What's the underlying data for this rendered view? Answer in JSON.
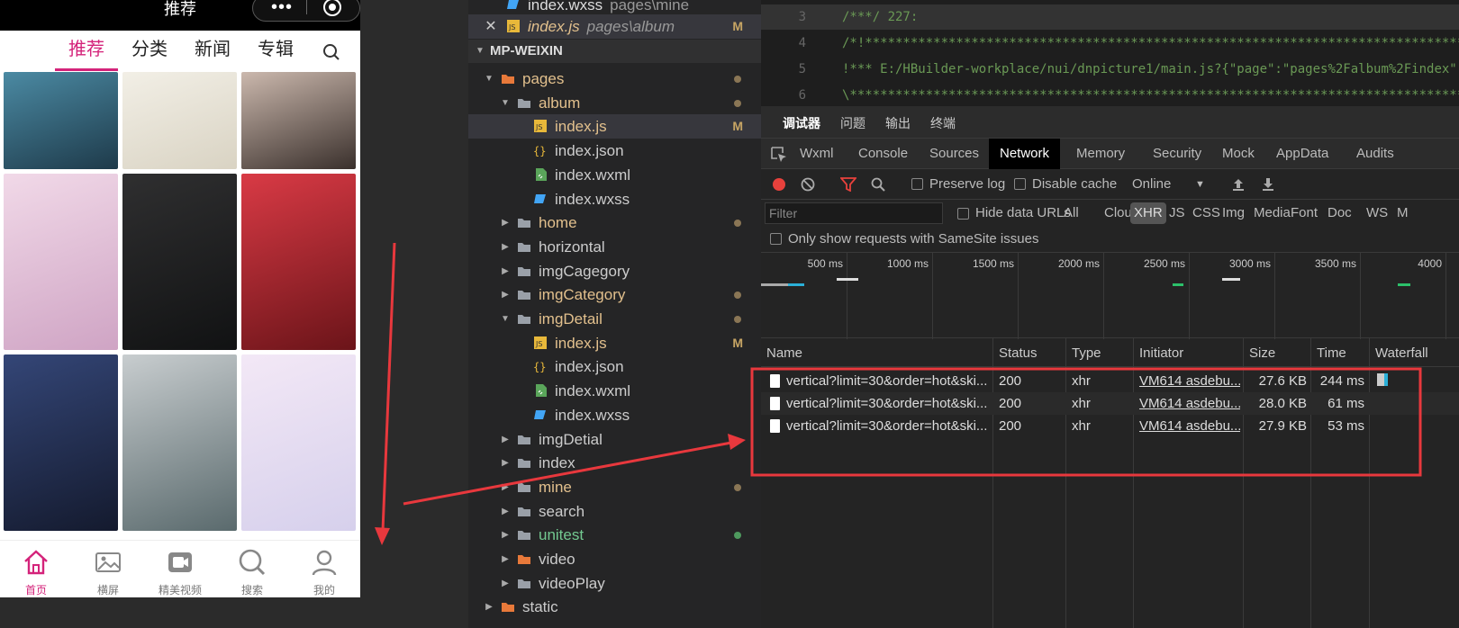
{
  "phone": {
    "title": "推荐",
    "nav": [
      "推荐",
      "分类",
      "新闻",
      "专辑"
    ],
    "tabs": [
      "首页",
      "横屏",
      "精美视频",
      "搜索",
      "我的"
    ],
    "accent": "#d4237a",
    "images": [
      {
        "name": "mountain-image",
        "colors": [
          "#4b8aa3",
          "#1e3a4a"
        ]
      },
      {
        "name": "meme-image",
        "colors": [
          "#f2efe6",
          "#d9d3c3"
        ]
      },
      {
        "name": "woman-dark-image",
        "colors": [
          "#cbb8ad",
          "#3a302c"
        ]
      },
      {
        "name": "woman-white-dress-image",
        "colors": [
          "#f1d9e8",
          "#cfa4c4"
        ]
      },
      {
        "name": "joker-image",
        "colors": [
          "#2f2f30",
          "#111213"
        ]
      },
      {
        "name": "red-costume-image",
        "colors": [
          "#d93a45",
          "#6b1419"
        ]
      },
      {
        "name": "superheroes-image",
        "colors": [
          "#344677",
          "#141a2e"
        ]
      },
      {
        "name": "woman-sequin-dress-image",
        "colors": [
          "#c8cdcf",
          "#5a6a6d"
        ]
      },
      {
        "name": "pastel-sky-image",
        "colors": [
          "#f3e8f6",
          "#d6d0ec"
        ]
      }
    ]
  },
  "explorer": {
    "open_file": {
      "name": "index.wxss",
      "path": "pages\\mine"
    },
    "active_tab": {
      "name": "index.js",
      "path": "pages\\album",
      "badge": "M"
    },
    "section": "MP-WEIXIN",
    "tree": [
      {
        "label": "pages",
        "kind": "folder-special",
        "depth": 0,
        "open": true,
        "status": "dot",
        "color": "mod"
      },
      {
        "label": "album",
        "kind": "folder",
        "depth": 1,
        "open": true,
        "status": "dot",
        "color": "mod"
      },
      {
        "label": "index.js",
        "kind": "js",
        "depth": 2,
        "status": "M",
        "color": "mod",
        "selected": true
      },
      {
        "label": "index.json",
        "kind": "json",
        "depth": 2
      },
      {
        "label": "index.wxml",
        "kind": "wxml",
        "depth": 2
      },
      {
        "label": "index.wxss",
        "kind": "wxss",
        "depth": 2
      },
      {
        "label": "home",
        "kind": "folder",
        "depth": 1,
        "open": false,
        "status": "dot",
        "color": "mod"
      },
      {
        "label": "horizontal",
        "kind": "folder",
        "depth": 1,
        "open": false
      },
      {
        "label": "imgCagegory",
        "kind": "folder",
        "depth": 1,
        "open": false
      },
      {
        "label": "imgCategory",
        "kind": "folder",
        "depth": 1,
        "open": false,
        "status": "dot",
        "color": "mod"
      },
      {
        "label": "imgDetail",
        "kind": "folder",
        "depth": 1,
        "open": true,
        "status": "dot",
        "color": "mod"
      },
      {
        "label": "index.js",
        "kind": "js",
        "depth": 2,
        "status": "M",
        "color": "mod"
      },
      {
        "label": "index.json",
        "kind": "json",
        "depth": 2
      },
      {
        "label": "index.wxml",
        "kind": "wxml",
        "depth": 2
      },
      {
        "label": "index.wxss",
        "kind": "wxss",
        "depth": 2
      },
      {
        "label": "imgDetial",
        "kind": "folder",
        "depth": 1,
        "open": false
      },
      {
        "label": "index",
        "kind": "folder",
        "depth": 1,
        "open": false
      },
      {
        "label": "mine",
        "kind": "folder",
        "depth": 1,
        "open": false,
        "status": "dot",
        "color": "mod"
      },
      {
        "label": "search",
        "kind": "folder",
        "depth": 1,
        "open": false
      },
      {
        "label": "unitest",
        "kind": "folder",
        "depth": 1,
        "open": false,
        "status": "dot-green",
        "color": "green"
      },
      {
        "label": "video",
        "kind": "folder-special",
        "depth": 1,
        "open": false
      },
      {
        "label": "videoPlay",
        "kind": "folder",
        "depth": 1,
        "open": false
      },
      {
        "label": "static",
        "kind": "folder-special",
        "depth": 0,
        "open": false
      }
    ]
  },
  "code": {
    "lines": [
      {
        "num": "3",
        "text": "/***/ 227:",
        "hl": true
      },
      {
        "num": "4",
        "text": "/*!***************************************************************************************************",
        "hl": false
      },
      {
        "num": "5",
        "text": "  !*** E:/HBuilder-workplace/nui/dnpicture1/main.js?{\"page\":\"pages%2Falbum%2Findex\"",
        "hl": false
      },
      {
        "num": "6",
        "text": "  \\*************************************************************************************************",
        "hl": false
      }
    ]
  },
  "devtools": {
    "top_tabs": [
      "调试器",
      "问题",
      "输出",
      "终端"
    ],
    "panels": [
      "Wxml",
      "Console",
      "Sources",
      "Network",
      "Memory",
      "Security",
      "Mock",
      "AppData",
      "Audits"
    ],
    "active_panel": "Network",
    "preserve_log": "Preserve log",
    "disable_cache": "Disable cache",
    "throttle": "Online",
    "filter_placeholder": "Filter",
    "hide_data_urls": "Hide data URLs",
    "filter_types": [
      "All",
      "Cloud",
      "XHR",
      "JS",
      "CSS",
      "Img",
      "Media",
      "Font",
      "Doc",
      "WS",
      "M"
    ],
    "active_filter": "XHR",
    "same_site": "Only show requests with SameSite issues",
    "ticks": [
      "500 ms",
      "1000 ms",
      "1500 ms",
      "2000 ms",
      "2500 ms",
      "3000 ms",
      "3500 ms",
      "4000"
    ],
    "columns": [
      "Name",
      "Status",
      "Type",
      "Initiator",
      "Size",
      "Time",
      "Waterfall"
    ],
    "rows": [
      {
        "name": "vertical?limit=30&order=hot&ski...",
        "status": "200",
        "type": "xhr",
        "initiator": "VM614 asdebu...",
        "size": "27.6 KB",
        "time": "244 ms"
      },
      {
        "name": "vertical?limit=30&order=hot&ski...",
        "status": "200",
        "type": "xhr",
        "initiator": "VM614 asdebu...",
        "size": "28.0 KB",
        "time": "61 ms"
      },
      {
        "name": "vertical?limit=30&order=hot&ski...",
        "status": "200",
        "type": "xhr",
        "initiator": "VM614 asdebu...",
        "size": "27.9 KB",
        "time": "53 ms"
      }
    ]
  },
  "annotation_color": "#e8383d"
}
